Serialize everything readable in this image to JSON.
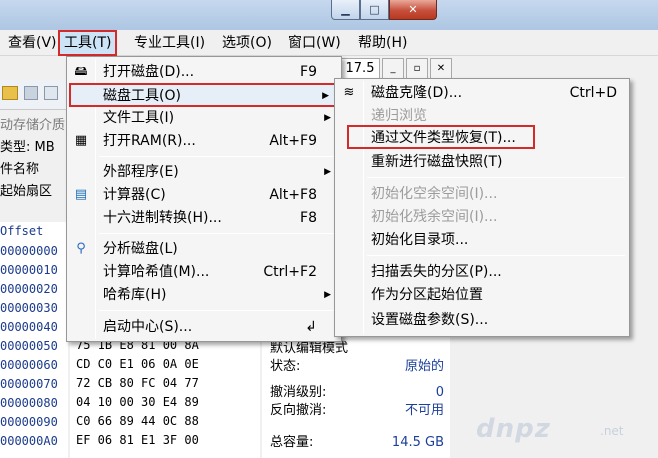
{
  "title_buttons": {
    "minimize": "▁",
    "maximize": "□",
    "close": "✕"
  },
  "menubar": [
    {
      "label": "查看(V)"
    },
    {
      "label": "工具(T)"
    },
    {
      "label": "专业工具(I)"
    },
    {
      "label": "选项(O)"
    },
    {
      "label": "窗口(W)"
    },
    {
      "label": "帮助(H)"
    }
  ],
  "zoom": "17.5",
  "mini_buttons": [
    "_",
    "▫",
    "✕"
  ],
  "side": {
    "media_label": "动存储介质",
    "type_label": "类型: MB",
    "name_label": "件名称",
    "sector_label": "起始扇区",
    "offset_header": "Offset"
  },
  "offsets": [
    "00000000",
    "00000010",
    "00000020",
    "00000030",
    "00000040",
    "00000050",
    "00000060",
    "00000070",
    "00000080",
    "00000090",
    "000000A0"
  ],
  "hex_rows": [
    "75 1B E8 81 00 8A",
    "CD C0 E1 06 0A 0E",
    "72 CB 80 FC 04 77",
    "04 10 00 30 E4 89",
    "C0 66 89 44 0C 88",
    "EF 06 81 E1 3F 00"
  ],
  "info": {
    "mode_label": "默认编辑模式",
    "rows": [
      {
        "label": "状态:",
        "value": "原始的"
      },
      {
        "label": "撤消级别:",
        "value": "0"
      },
      {
        "label": "反向撤消:",
        "value": "不可用"
      },
      {
        "label": "总容量:",
        "value": "14.5 GB"
      }
    ]
  },
  "tools_menu": {
    "open_disk": {
      "label": "打开磁盘(D)...",
      "shortcut": "F9"
    },
    "disk_tools": {
      "label": "磁盘工具(O)"
    },
    "file_tools": {
      "label": "文件工具(I)"
    },
    "open_ram": {
      "label": "打开RAM(R)...",
      "shortcut": "Alt+F9"
    },
    "external": {
      "label": "外部程序(E)"
    },
    "calculator": {
      "label": "计算器(C)",
      "shortcut": "Alt+F8"
    },
    "hex_convert": {
      "label": "十六进制转换(H)...",
      "shortcut": "F8"
    },
    "analyze": {
      "label": "分析磁盘(L)"
    },
    "hash": {
      "label": "计算哈希值(M)...",
      "shortcut": "Ctrl+F2"
    },
    "hash_db": {
      "label": "哈希库(H)"
    },
    "start_center": {
      "label": "启动中心(S)...",
      "shortcut": "↲"
    }
  },
  "disk_submenu": {
    "clone": {
      "label": "磁盘克隆(D)...",
      "shortcut": "Ctrl+D"
    },
    "recursive": {
      "label": "递归浏览"
    },
    "by_type": {
      "label": "通过文件类型恢复(T)..."
    },
    "snapshot": {
      "label": "重新进行磁盘快照(T)"
    },
    "init_free": {
      "label": "初始化空余空间(I)..."
    },
    "init_slack": {
      "label": "初始化残余空间(I)..."
    },
    "init_dir": {
      "label": "初始化目录项..."
    },
    "scan_lost": {
      "label": "扫描丢失的分区(P)..."
    },
    "as_partition": {
      "label": "作为分区起始位置"
    },
    "set_params": {
      "label": "设置磁盘参数(S)..."
    }
  },
  "watermark": {
    "main": "dnpz",
    "sub": ".net"
  }
}
